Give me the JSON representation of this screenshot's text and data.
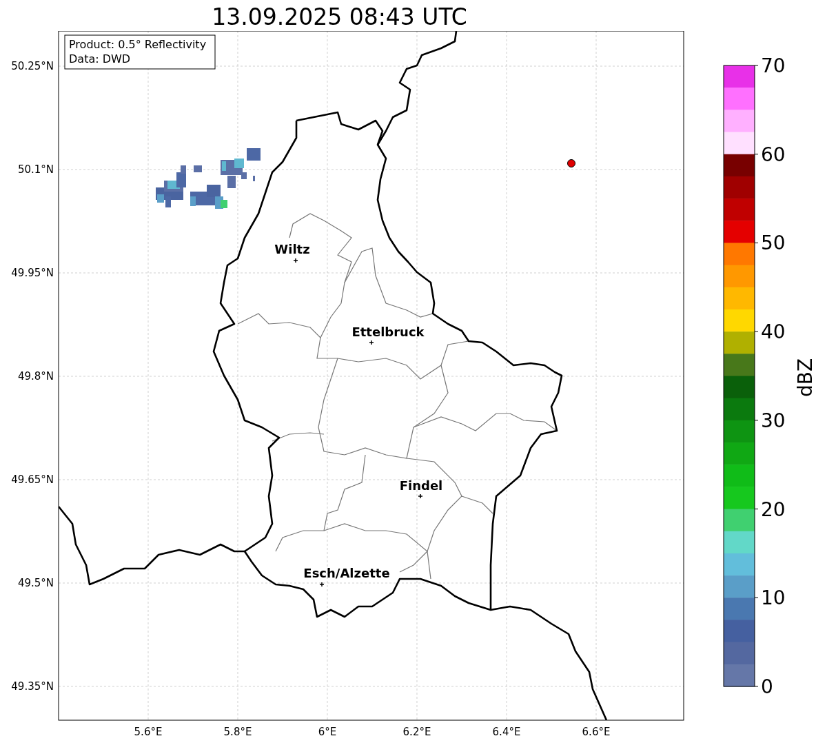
{
  "title": "13.09.2025 08:43 UTC",
  "info_box": [
    "Product: 0.5° Reflectivity",
    "Data: DWD"
  ],
  "x_ticks": [
    "5.6°E",
    "5.8°E",
    "6°E",
    "6.2°E",
    "6.4°E",
    "6.6°E"
  ],
  "y_ticks": [
    "50.25°N",
    "50.1°N",
    "49.95°N",
    "49.8°N",
    "49.65°N",
    "49.5°N",
    "49.35°N"
  ],
  "places": [
    {
      "name": "Wiltz"
    },
    {
      "name": "Ettelbruck"
    },
    {
      "name": "Findel"
    },
    {
      "name": "Esch/Alzette"
    }
  ],
  "colorbar": {
    "label": "dBZ",
    "ticks": [
      "70",
      "60",
      "50",
      "40",
      "30",
      "20",
      "10",
      "0"
    ],
    "segments": [
      {
        "color": "#e830e8"
      },
      {
        "color": "#ff70ff"
      },
      {
        "color": "#ffb0ff"
      },
      {
        "color": "#ffe0ff"
      },
      {
        "color": "#780000"
      },
      {
        "color": "#a00000"
      },
      {
        "color": "#c00000"
      },
      {
        "color": "#e40000"
      },
      {
        "color": "#ff7800"
      },
      {
        "color": "#ff9800"
      },
      {
        "color": "#ffb800"
      },
      {
        "color": "#ffd800"
      },
      {
        "color": "#b0b000"
      },
      {
        "color": "#48781a"
      },
      {
        "color": "#0a600a"
      },
      {
        "color": "#0b7a0e"
      },
      {
        "color": "#0e9412"
      },
      {
        "color": "#10a814"
      },
      {
        "color": "#10bc18"
      },
      {
        "color": "#16c81e"
      },
      {
        "color": "#40d070"
      },
      {
        "color": "#62d8c8"
      },
      {
        "color": "#62bedb"
      },
      {
        "color": "#5a9ec8"
      },
      {
        "color": "#4a78b0"
      },
      {
        "color": "#4560a0"
      },
      {
        "color": "#5468a0"
      },
      {
        "color": "#6577a8"
      }
    ]
  }
}
